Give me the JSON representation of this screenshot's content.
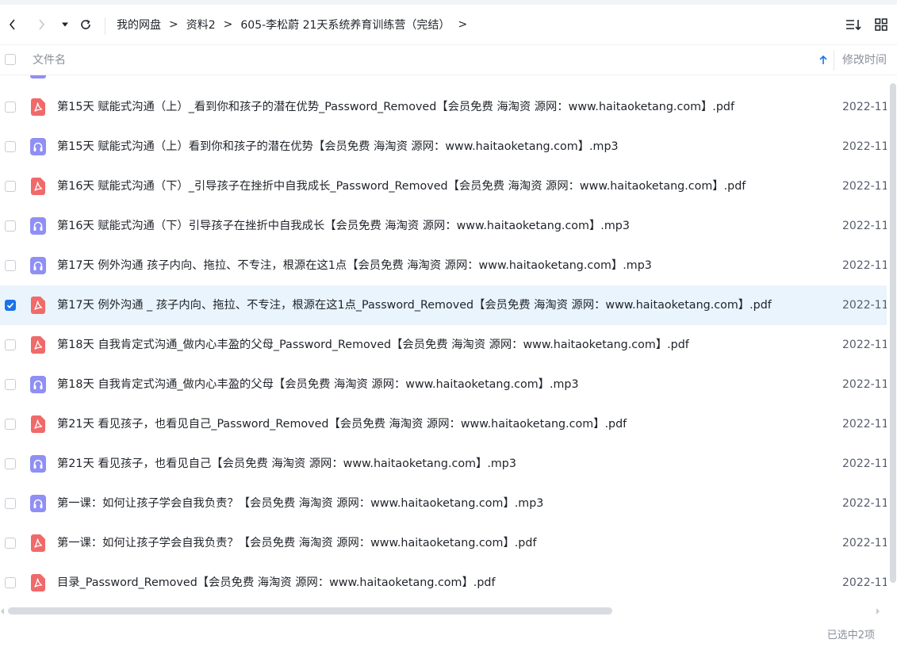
{
  "nav": {
    "back_icon": "chevron-left-icon",
    "forward_icon": "chevron-right-icon",
    "dropdown_icon": "caret-down-icon",
    "refresh_icon": "refresh-icon",
    "breadcrumbs": [
      "我的网盘",
      "资料2",
      "605-李松蔚 21天系统养育训练营（完结）"
    ],
    "separator": ">",
    "sort_icon": "sort-list-icon",
    "grid_icon": "grid-view-icon"
  },
  "header": {
    "name_label": "文件名",
    "modified_label": "修改时间",
    "sort_indicator": "↑"
  },
  "colors": {
    "accent": "#1a73e8",
    "pdf": "#f06a6a",
    "audio": "#8f8ff5",
    "selected_row": "#e9f4fd"
  },
  "files": [
    {
      "name": "第15天 赋能式沟通（上）_看到你和孩子的潜在优势_Password_Removed【会员免费 海淘资 源网：www.haitaoketang.com】.pdf",
      "type": "pdf",
      "date": "2022-11",
      "selected": false
    },
    {
      "name": "第15天 赋能式沟通（上）看到你和孩子的潜在优势【会员免费 海淘资 源网：www.haitaoketang.com】.mp3",
      "type": "audio",
      "date": "2022-11",
      "selected": false
    },
    {
      "name": "第16天 赋能式沟通（下）_引导孩子在挫折中自我成长_Password_Removed【会员免费 海淘资 源网：www.haitaoketang.com】.pdf",
      "type": "pdf",
      "date": "2022-11",
      "selected": false
    },
    {
      "name": "第16天 赋能式沟通（下）引导孩子在挫折中自我成长【会员免费 海淘资 源网：www.haitaoketang.com】.mp3",
      "type": "audio",
      "date": "2022-11",
      "selected": false
    },
    {
      "name": "第17天 例外沟通  孩子内向、拖拉、不专注，根源在这1点【会员免费 海淘资 源网：www.haitaoketang.com】.mp3",
      "type": "audio",
      "date": "2022-11",
      "selected": false
    },
    {
      "name": "第17天 例外沟通 _ 孩子内向、拖拉、不专注，根源在这1点_Password_Removed【会员免费 海淘资 源网：www.haitaoketang.com】.pdf",
      "type": "pdf",
      "date": "2022-11",
      "selected": true
    },
    {
      "name": "第18天 自我肯定式沟通_做内心丰盈的父母_Password_Removed【会员免费 海淘资 源网：www.haitaoketang.com】.pdf",
      "type": "pdf",
      "date": "2022-11",
      "selected": false
    },
    {
      "name": "第18天 自我肯定式沟通_做内心丰盈的父母【会员免费 海淘资 源网：www.haitaoketang.com】.mp3",
      "type": "audio",
      "date": "2022-11",
      "selected": false
    },
    {
      "name": "第21天 看见孩子，也看见自己_Password_Removed【会员免费 海淘资 源网：www.haitaoketang.com】.pdf",
      "type": "pdf",
      "date": "2022-11",
      "selected": false
    },
    {
      "name": "第21天 看见孩子，也看见自己【会员免费 海淘资 源网：www.haitaoketang.com】.mp3",
      "type": "audio",
      "date": "2022-11",
      "selected": false
    },
    {
      "name": "第一课：如何让孩子学会自我负责？【会员免费 海淘资 源网：www.haitaoketang.com】.mp3",
      "type": "audio",
      "date": "2022-11",
      "selected": false
    },
    {
      "name": "第一课：如何让孩子学会自我负责？【会员免费 海淘资 源网：www.haitaoketang.com】.pdf",
      "type": "pdf",
      "date": "2022-11",
      "selected": false
    },
    {
      "name": "目录_Password_Removed【会员免费 海淘资 源网：www.haitaoketang.com】.pdf",
      "type": "pdf",
      "date": "2022-11",
      "selected": false
    }
  ],
  "status": {
    "selection_text": "已选中2项"
  }
}
